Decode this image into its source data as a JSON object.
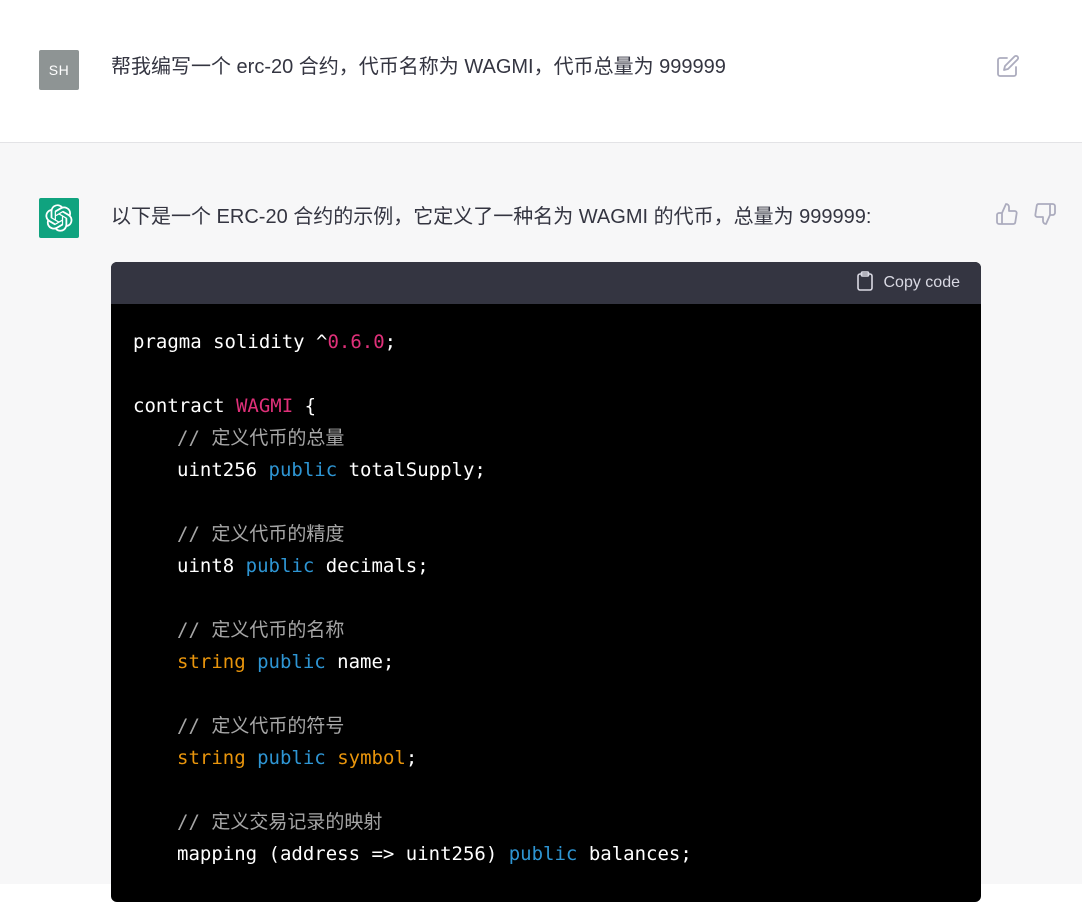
{
  "user": {
    "avatar_initials": "SH",
    "message": "帮我编写一个 erc-20 合约，代币名称为  WAGMI，代币总量为 999999"
  },
  "assistant": {
    "intro": "以下是一个 ERC-20 合约的示例，它定义了一种名为 WAGMI 的代币，总量为 999999:",
    "copy_label": "Copy code",
    "code": {
      "l1_kw": "pragma solidity ^",
      "l1_ver": "0.6.0",
      "l1_end": ";",
      "l3_kw": "contract ",
      "l3_name": "WAGMI",
      "l3_end": " {",
      "c1": "// 定义代币的总量",
      "l5_type": "uint256 ",
      "l5_mod": "public",
      "l5_var": " totalSupply;",
      "c2": "// 定义代币的精度",
      "l8_type": "uint8 ",
      "l8_mod": "public",
      "l8_var": " decimals;",
      "c3": "// 定义代币的名称",
      "l11_type": "string",
      "l11_mod": "public",
      "l11_var": " name;",
      "c4": "// 定义代币的符号",
      "l14_type": "string",
      "l14_mod": "public",
      "l14_var": "symbol",
      "l14_end": ";",
      "c5": "// 定义交易记录的映射",
      "l17_type": "mapping (address => uint256) ",
      "l17_mod": "public",
      "l17_var": " balances;"
    }
  },
  "colors": {
    "bot_avatar": "#10a37f",
    "user_avatar": "#8e9494",
    "code_bg": "#000000",
    "code_header": "#343541",
    "keyword": "#2e95d3",
    "number": "#df3079",
    "type": "#e9950c",
    "comment": "#a6a6a6"
  }
}
